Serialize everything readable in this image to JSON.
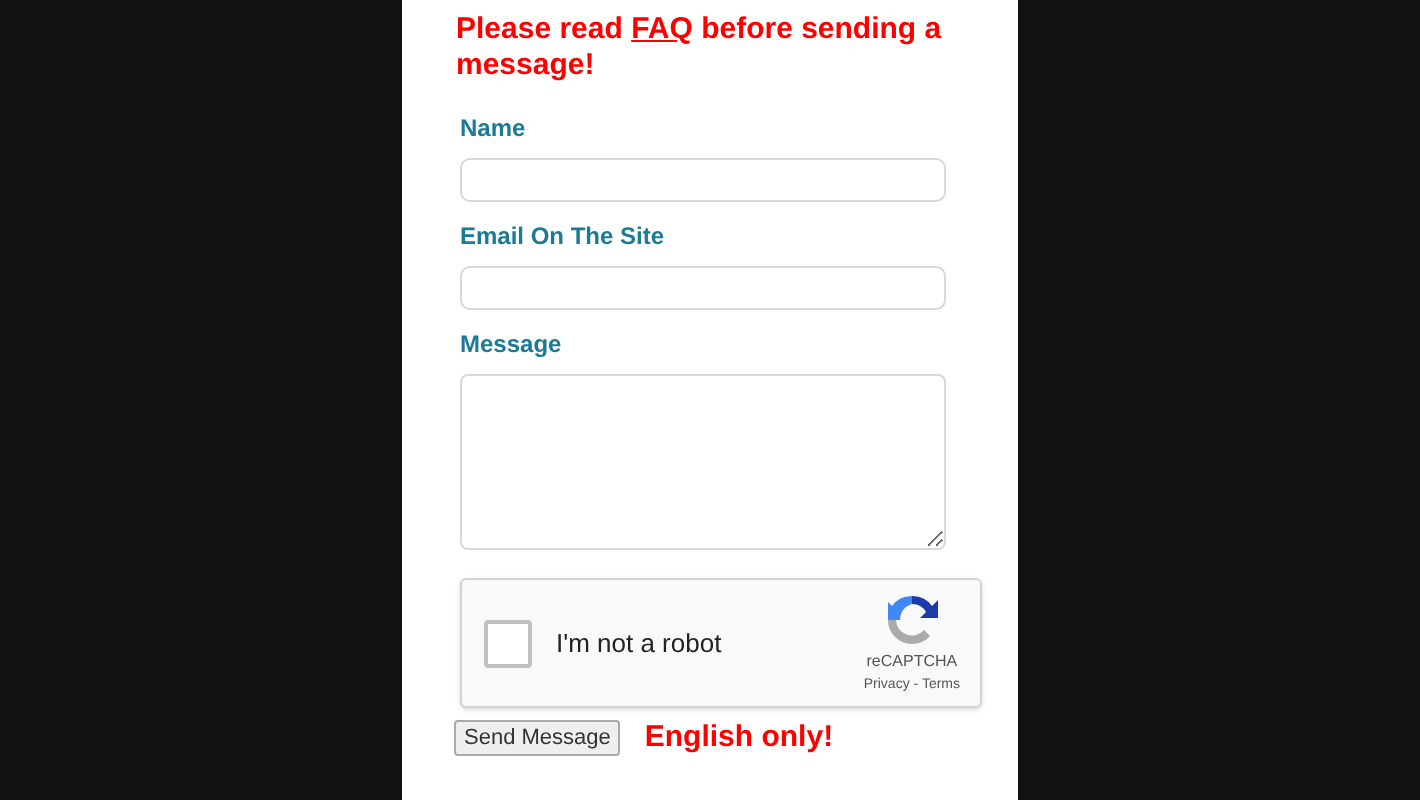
{
  "notice": {
    "before": "Please read ",
    "link": "FAQ",
    "after": " before sending a message!"
  },
  "fields": [
    {
      "label": "Name",
      "kind": "text"
    },
    {
      "label": "Email On The Site",
      "kind": "text"
    },
    {
      "label": "Message",
      "kind": "textarea"
    }
  ],
  "captcha": {
    "label": "I'm not a robot",
    "checked": false,
    "brand": "reCAPTCHA",
    "privacy": "Privacy",
    "separator": " - ",
    "terms": "Terms"
  },
  "submit": "Send Message",
  "note": "English only!"
}
